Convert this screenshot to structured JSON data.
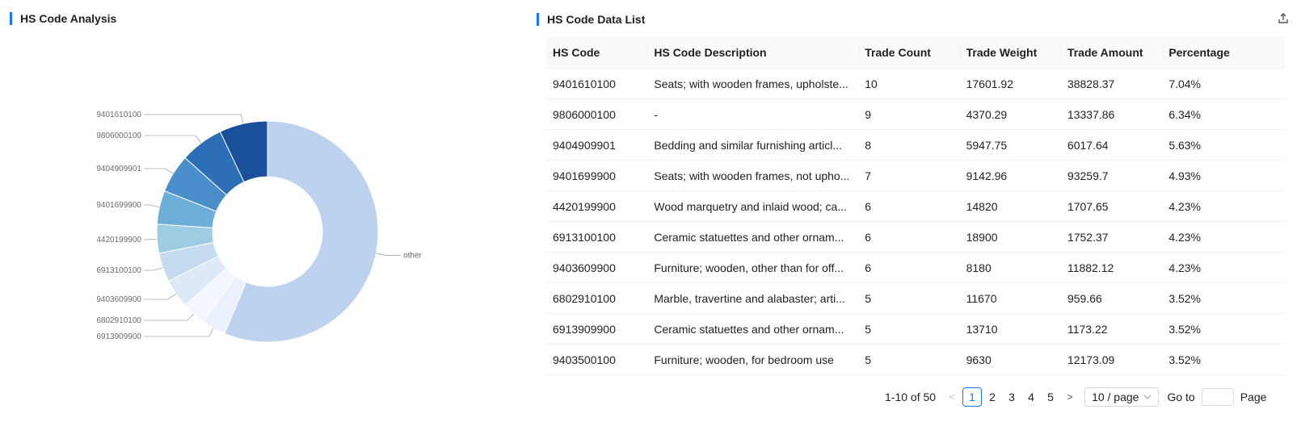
{
  "left_panel": {
    "title": "HS Code Analysis"
  },
  "right_panel": {
    "title": "HS Code Data List",
    "export_icon": "export-icon"
  },
  "chart_data": {
    "type": "pie",
    "donut": true,
    "slices": [
      {
        "label": "9401610100",
        "value": 7.04,
        "color": "#1a4f9b"
      },
      {
        "label": "9806000100",
        "value": 6.34,
        "color": "#2c6fb8"
      },
      {
        "label": "9404909901",
        "value": 5.63,
        "color": "#4a8fcb"
      },
      {
        "label": "9401699900",
        "value": 4.93,
        "color": "#6daed9"
      },
      {
        "label": "4420199900",
        "value": 4.23,
        "color": "#9ecce3"
      },
      {
        "label": "6913100100",
        "value": 4.23,
        "color": "#c5dcf0"
      },
      {
        "label": "9403609900",
        "value": 4.23,
        "color": "#dde9f7"
      },
      {
        "label": "6802910100",
        "value": 3.52,
        "color": "#f3f7fd"
      },
      {
        "label": "6913909900",
        "value": 3.52,
        "color": "#eaf1fc"
      },
      {
        "label": "other",
        "value": 56.33,
        "color": "#bcd2ef"
      }
    ]
  },
  "table": {
    "headers": [
      "HS Code",
      "HS Code Description",
      "Trade Count",
      "Trade Weight",
      "Trade Amount",
      "Percentage"
    ],
    "rows": [
      [
        "9401610100",
        "Seats; with wooden frames, upholste...",
        "10",
        "17601.92",
        "38828.37",
        "7.04%"
      ],
      [
        "9806000100",
        "-",
        "9",
        "4370.29",
        "13337.86",
        "6.34%"
      ],
      [
        "9404909901",
        "Bedding and similar furnishing articl...",
        "8",
        "5947.75",
        "6017.64",
        "5.63%"
      ],
      [
        "9401699900",
        "Seats; with wooden frames, not upho...",
        "7",
        "9142.96",
        "93259.7",
        "4.93%"
      ],
      [
        "4420199900",
        "Wood marquetry and inlaid wood; ca...",
        "6",
        "14820",
        "1707.65",
        "4.23%"
      ],
      [
        "6913100100",
        "Ceramic statuettes and other ornam...",
        "6",
        "18900",
        "1752.37",
        "4.23%"
      ],
      [
        "9403609900",
        "Furniture; wooden, other than for off...",
        "6",
        "8180",
        "11882.12",
        "4.23%"
      ],
      [
        "6802910100",
        "Marble, travertine and alabaster; arti...",
        "5",
        "11670",
        "959.66",
        "3.52%"
      ],
      [
        "6913909900",
        "Ceramic statuettes and other ornam...",
        "5",
        "13710",
        "1173.22",
        "3.52%"
      ],
      [
        "9403500100",
        "Furniture; wooden, for bedroom use",
        "5",
        "9630",
        "12173.09",
        "3.52%"
      ]
    ]
  },
  "pagination": {
    "total_text": "1-10 of 50",
    "prev": "<",
    "next": ">",
    "pages": [
      "1",
      "2",
      "3",
      "4",
      "5"
    ],
    "current_page": "1",
    "page_size": "10 / page",
    "goto_label": "Go to",
    "page_label": "Page"
  }
}
